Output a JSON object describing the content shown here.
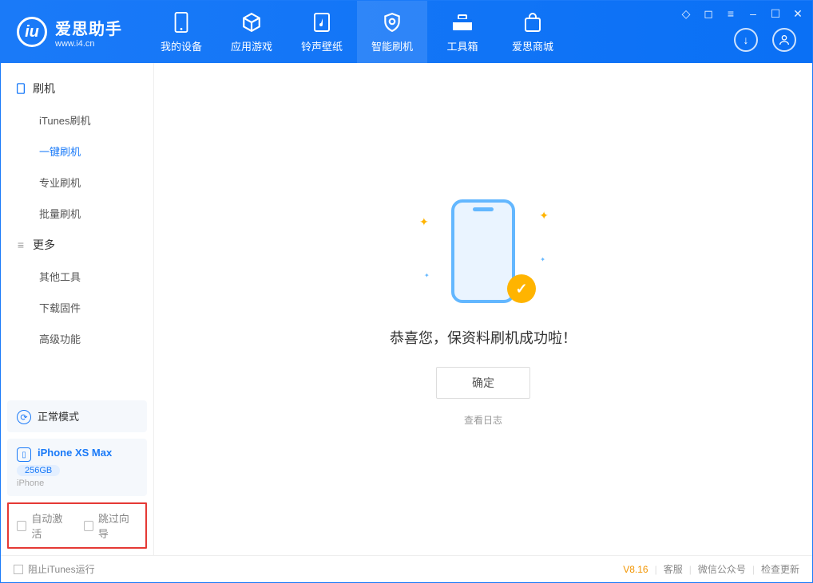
{
  "brand": {
    "name": "爱思助手",
    "url": "www.i4.cn"
  },
  "tabs": [
    {
      "label": "我的设备",
      "icon": "device"
    },
    {
      "label": "应用游戏",
      "icon": "cube"
    },
    {
      "label": "铃声壁纸",
      "icon": "music"
    },
    {
      "label": "智能刷机",
      "icon": "shield",
      "active": true
    },
    {
      "label": "工具箱",
      "icon": "toolbox"
    },
    {
      "label": "爱思商城",
      "icon": "bag"
    }
  ],
  "sidebar": {
    "group1_title": "刷机",
    "group1_items": [
      {
        "label": "iTunes刷机"
      },
      {
        "label": "一键刷机",
        "active": true
      },
      {
        "label": "专业刷机"
      },
      {
        "label": "批量刷机"
      }
    ],
    "group2_title": "更多",
    "group2_items": [
      {
        "label": "其他工具"
      },
      {
        "label": "下载固件"
      },
      {
        "label": "高级功能"
      }
    ]
  },
  "mode": {
    "label": "正常模式"
  },
  "device": {
    "name": "iPhone XS Max",
    "capacity": "256GB",
    "type": "iPhone"
  },
  "bottom_checks": {
    "auto_activate": "自动激活",
    "skip_guide": "跳过向导"
  },
  "main": {
    "success_msg": "恭喜您，保资料刷机成功啦！",
    "ok_label": "确定",
    "log_link": "查看日志"
  },
  "statusbar": {
    "stop_itunes": "阻止iTunes运行",
    "version": "V8.16",
    "service": "客服",
    "wechat": "微信公众号",
    "check_update": "检查更新"
  }
}
